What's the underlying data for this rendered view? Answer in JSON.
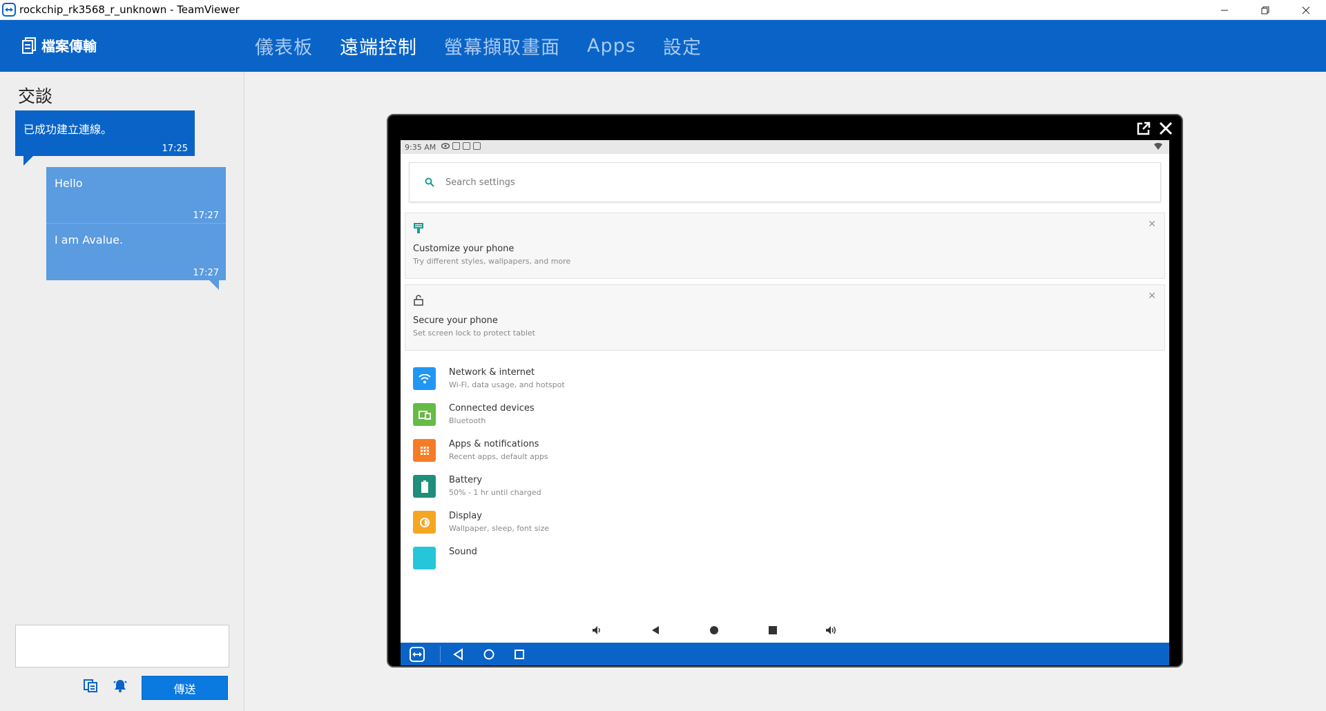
{
  "window": {
    "title": "rockchip_rk3568_r_unknown - TeamViewer",
    "controls": [
      "minimize-icon",
      "restore-icon",
      "close-icon"
    ]
  },
  "topnav": {
    "file_transfer": "檔案傳輸",
    "tabs": [
      {
        "label": "儀表板",
        "active": false
      },
      {
        "label": "遠端控制",
        "active": true
      },
      {
        "label": "螢幕擷取畫面",
        "active": false
      },
      {
        "label": "Apps",
        "active": false
      },
      {
        "label": "設定",
        "active": false
      }
    ]
  },
  "chat": {
    "title": "交談",
    "messages": [
      {
        "text": "已成功建立連線。",
        "time": "17:25",
        "type": "system"
      },
      {
        "text": "Hello",
        "time": "17:27",
        "type": "user"
      },
      {
        "text": "I am Avalue.",
        "time": "17:27",
        "type": "user"
      }
    ],
    "input_value": "",
    "send_label": "傳送",
    "icons": [
      "file-send-icon",
      "bell-icon"
    ]
  },
  "device": {
    "statusbar_time": "9:35 AM",
    "search_placeholder": "Search settings",
    "suggestions": [
      {
        "title": "Customize your phone",
        "subtitle": "Try different styles, wallpapers, and more",
        "icon": "brush-icon"
      },
      {
        "title": "Secure your phone",
        "subtitle": "Set screen lock to protect tablet",
        "icon": "lock-icon"
      }
    ],
    "settings": [
      {
        "title": "Network & internet",
        "subtitle": "Wi-Fi, data usage, and hotspot",
        "color": "#2196f3",
        "icon": "wifi-icon"
      },
      {
        "title": "Connected devices",
        "subtitle": "Bluetooth",
        "color": "#66bb44",
        "icon": "devices-icon"
      },
      {
        "title": "Apps & notifications",
        "subtitle": "Recent apps, default apps",
        "color": "#f57c25",
        "icon": "apps-icon"
      },
      {
        "title": "Battery",
        "subtitle": "50% - 1 hr until charged",
        "color": "#1e8f7a",
        "icon": "battery-icon"
      },
      {
        "title": "Display",
        "subtitle": "Wallpaper, sleep, font size",
        "color": "#f5a623",
        "icon": "display-icon"
      },
      {
        "title": "Sound",
        "subtitle": "",
        "color": "#26c6da",
        "icon": "sound-icon"
      }
    ]
  }
}
